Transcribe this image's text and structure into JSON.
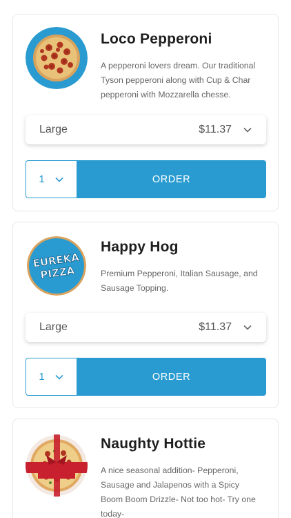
{
  "products": [
    {
      "name": "Loco Pepperoni",
      "description": "A pepperoni lovers dream. Our traditional Tyson pepperoni along with Cup & Char pepperoni with Mozzarella chesse.",
      "size": "Large",
      "price": "$11.37",
      "quantity": "1",
      "order_label": "ORDER"
    },
    {
      "name": "Happy Hog",
      "description": "Premium Pepperoni, Italian Sausage, and Sausage Topping.",
      "size": "Large",
      "price": "$11.37",
      "quantity": "1",
      "order_label": "ORDER",
      "logo_text": [
        "EUREKA",
        "PIZZA"
      ]
    },
    {
      "name": "Naughty Hottie",
      "description": "A nice seasonal addition- Pepperoni, Sausage and Jalapenos with a Spicy Boom Boom Drizzle- Not too hot- Try one today-"
    }
  ],
  "colors": {
    "accent": "#2a9bd0",
    "thumb_bg": "#2a9bd0"
  },
  "icons": {
    "dropdown": "chevron-down-icon"
  }
}
